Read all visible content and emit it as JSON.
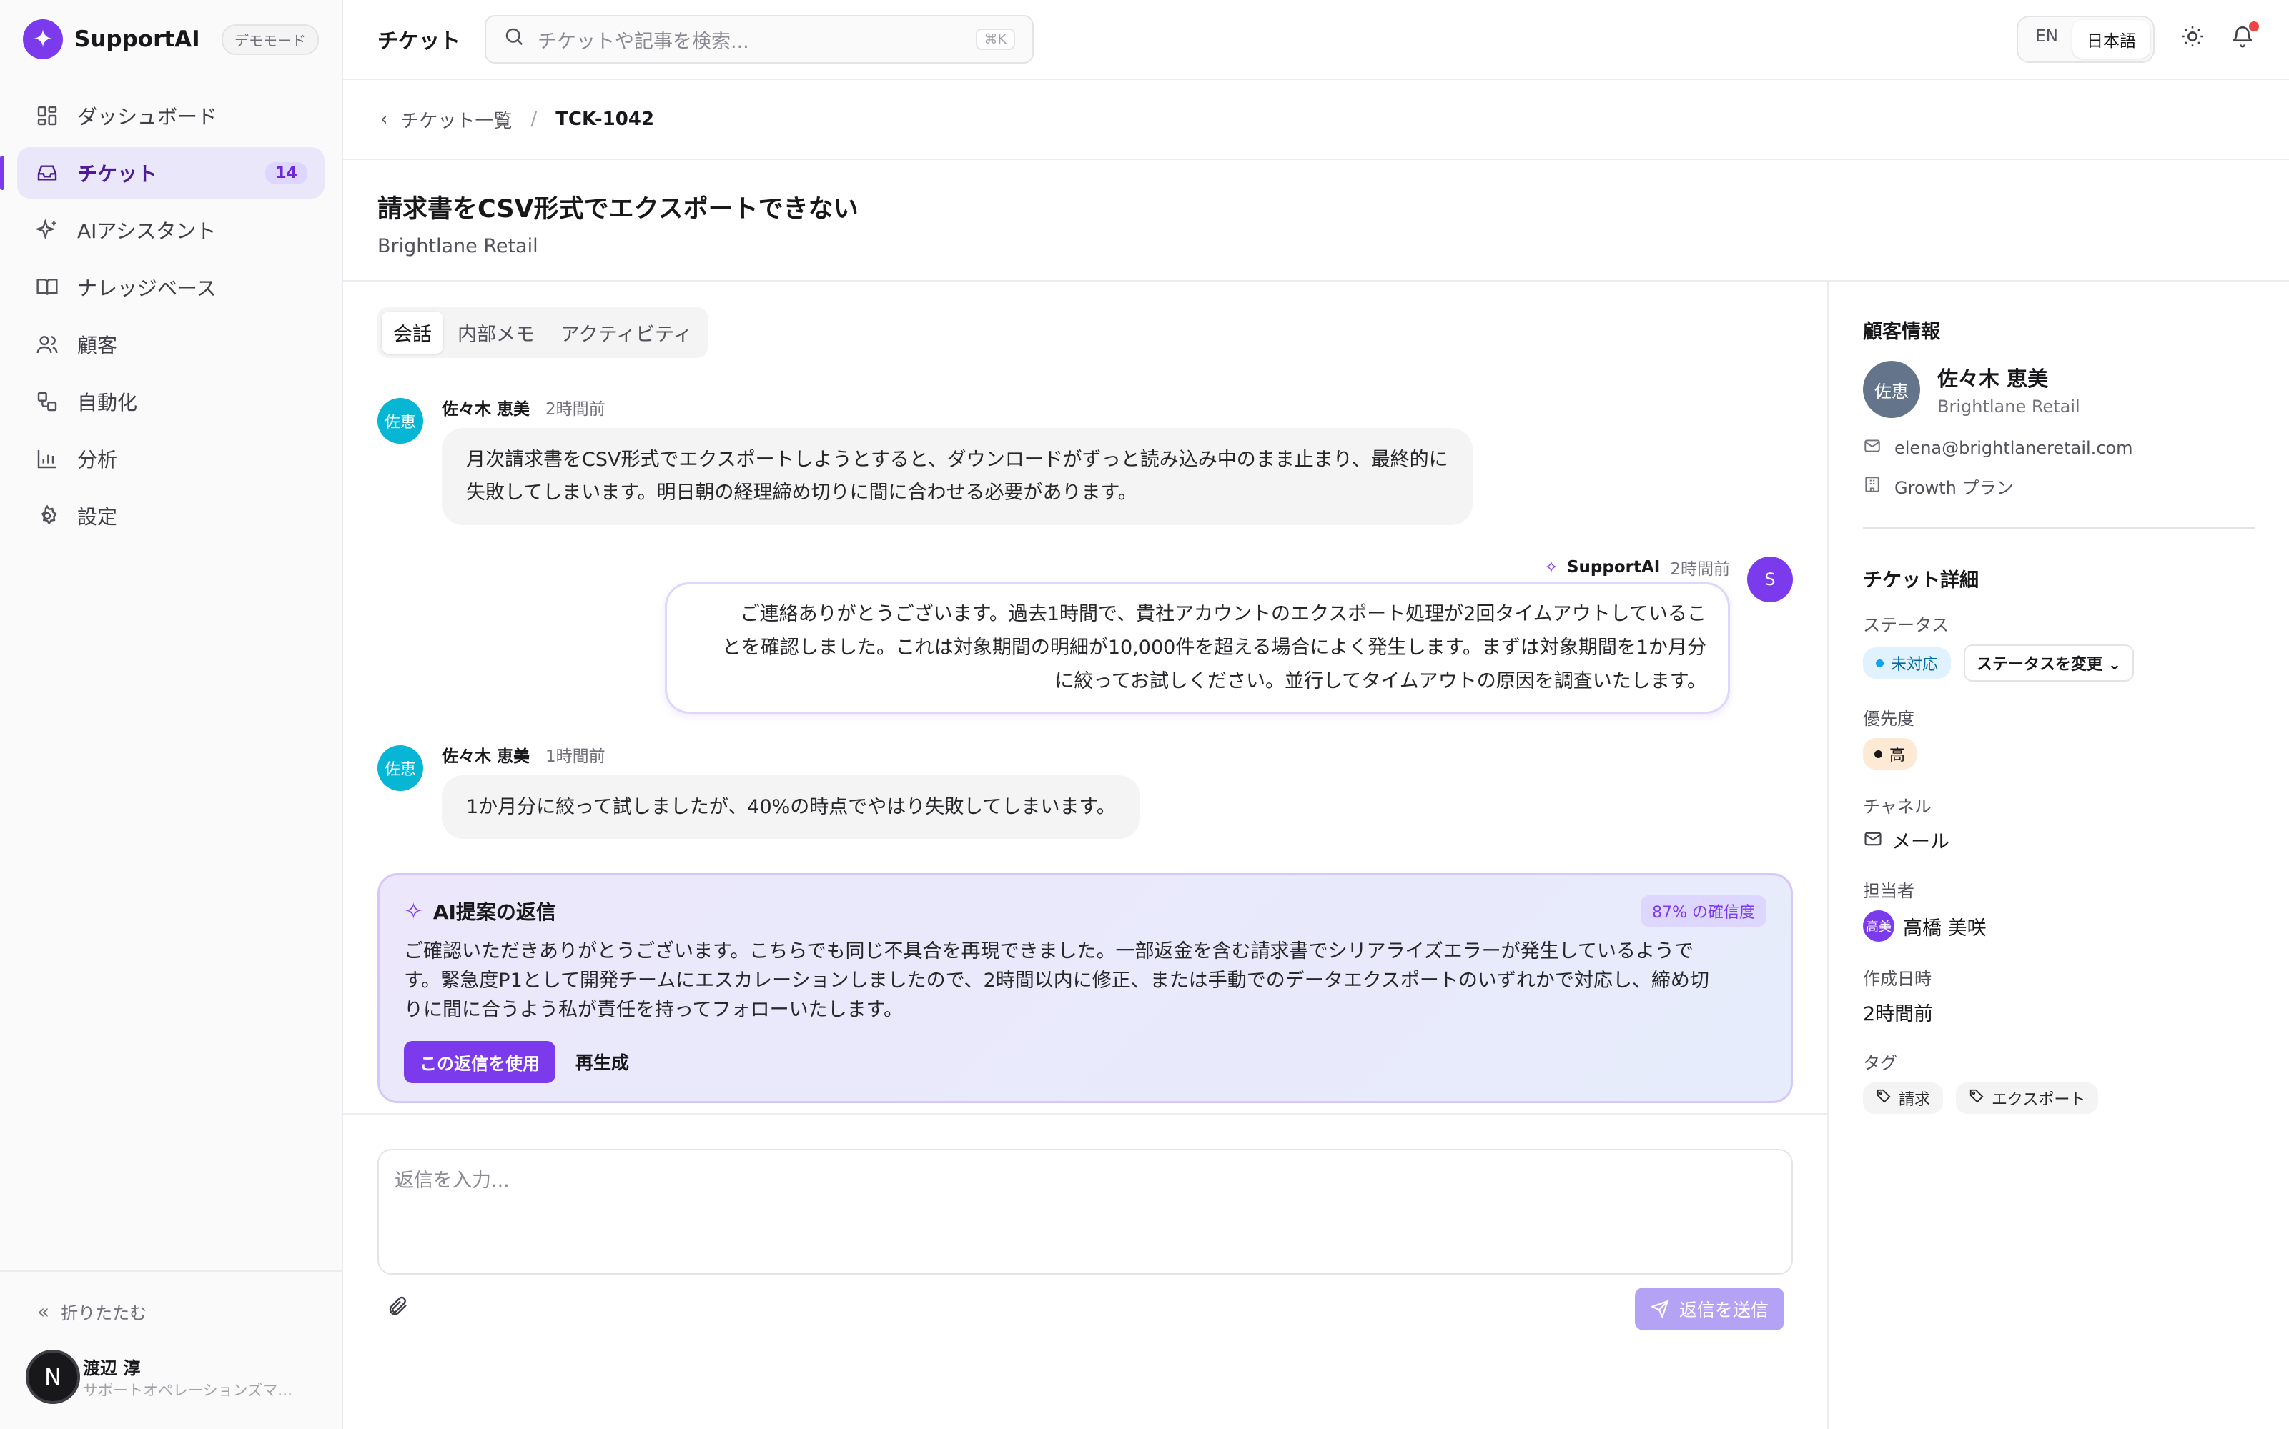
{
  "brand": {
    "name": "SupportAI",
    "logo_glyph": "✦",
    "demo_badge": "デモモード",
    "accent": "#7c3aed"
  },
  "sidebar": {
    "items": [
      {
        "label": "ダッシュボード",
        "icon": "dashboard-icon",
        "glyph": "⊞"
      },
      {
        "label": "チケット",
        "icon": "inbox-icon",
        "glyph": "▭",
        "count": "14",
        "active": true
      },
      {
        "label": "AIアシスタント",
        "icon": "sparkles-icon",
        "glyph": "✧"
      },
      {
        "label": "ナレッジベース",
        "icon": "book-icon",
        "glyph": "▯"
      },
      {
        "label": "顧客",
        "icon": "users-icon",
        "glyph": "☺"
      },
      {
        "label": "自動化",
        "icon": "workflow-icon",
        "glyph": "⧉"
      },
      {
        "label": "分析",
        "icon": "chart-icon",
        "glyph": "▥"
      },
      {
        "label": "設定",
        "icon": "gear-icon",
        "glyph": "⚙"
      }
    ],
    "collapse_label": "折りたたむ",
    "user": {
      "initial": "N",
      "name": "渡辺 淳",
      "role": "サポートオペレーションズマネージャー"
    }
  },
  "topbar": {
    "title": "チケット",
    "search_placeholder": "チケットや記事を検索...",
    "search_shortcut": "⌘K",
    "lang": [
      "EN",
      "日本語"
    ],
    "lang_selected": "日本語"
  },
  "breadcrumb": {
    "parent": "チケット一覧",
    "current": "TCK-1042"
  },
  "ticket": {
    "title": "請求書をCSV形式でエクスポートできない",
    "org": "Brightlane Retail"
  },
  "tabs": [
    "会話",
    "内部メモ",
    "アクティビティ"
  ],
  "messages": {
    "m1": {
      "avatar": "佐恵",
      "author": "佐々木 恵美",
      "time": "2時間前",
      "lines": [
        "月次請求書をCSV形式でエクスポートしようとすると、ダウンロードがずっと読み込み中のまま止まり、最終的に",
        "失敗してしまいます。明日朝の経理締め切りに間に合わせる必要があります。"
      ]
    },
    "m2": {
      "avatar": "S",
      "author": "SupportAI",
      "time": "2時間前",
      "lines": [
        "ご連絡ありがとうございます。過去1時間で、貴社アカウントのエクスポート処理が2回タイムアウトしているこ",
        "とを確認しました。これは対象期間の明細が10,000件を超える場合によく発生します。まずは対象期間を1か月分",
        "に絞ってお試しください。並行してタイムアウトの原因を調査いたします。"
      ]
    },
    "m3": {
      "avatar": "佐恵",
      "author": "佐々木 恵美",
      "time": "1時間前",
      "text": "1か月分に絞って試しましたが、40%の時点でやはり失敗してしまいます。"
    }
  },
  "ai_suggestion": {
    "title": "AI提案の返信",
    "confidence": "87% の確信度",
    "lines": [
      "ご確認いただきありがとうございます。こちらでも同じ不具合を再現できました。一部返金を含む請求書でシリアライズエラーが発生しているようで",
      "す。緊急度P1として開発チームにエスカレーションしましたので、2時間以内に修正、または手動でのデータエクスポートのいずれかで対応し、締め切",
      "りに間に合うよう私が責任を持ってフォローいたします。"
    ],
    "use_label": "この返信を使用",
    "regen_label": "再生成"
  },
  "composer": {
    "placeholder": "返信を入力...",
    "send_label": "返信を送信"
  },
  "panel": {
    "customer_heading": "顧客情報",
    "customer": {
      "avatar": "佐恵",
      "name": "佐々木 恵美",
      "org": "Brightlane Retail",
      "email": "elena@brightlaneretail.com",
      "plan": "Growth プラン"
    },
    "details_heading": "チケット詳細",
    "status_label": "ステータス",
    "status": "未対応",
    "status_change": "ステータスを変更",
    "priority_label": "優先度",
    "priority": "高",
    "channel_label": "チャネル",
    "channel": "メール",
    "assignee_label": "担当者",
    "assignee_avatar": "高美",
    "assignee": "高橋 美咲",
    "created_label": "作成日時",
    "created": "2時間前",
    "tags_label": "タグ",
    "tags": [
      "請求",
      "エクスポート"
    ]
  }
}
